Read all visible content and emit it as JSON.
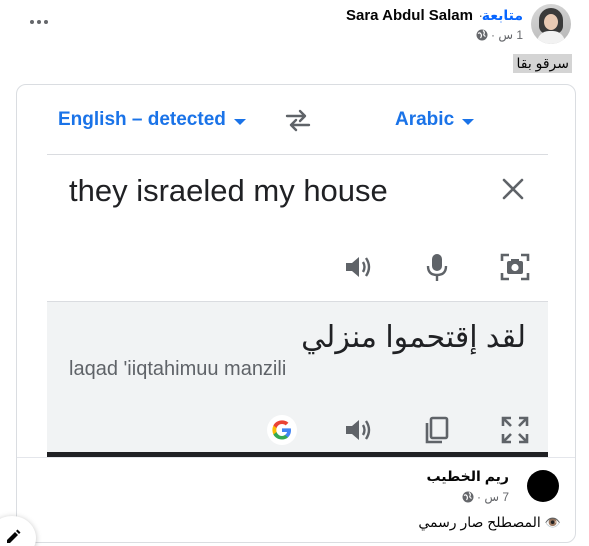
{
  "post": {
    "author": "Sara Abdul Salam",
    "separator": "·",
    "follow_label": "متابعة",
    "time": "1 س ·",
    "privacy_icon": "globe-icon",
    "more_icon": "more-options-icon",
    "caption": "سرقو بقا"
  },
  "translate": {
    "source_language": "English – detected",
    "target_language": "Arabic",
    "source_text": "they israeled my house",
    "translated_text": "لقد إقتحموا منزلي",
    "romanization": "laqad 'iiqtahimuu manzili",
    "accent_color": "#1a73e8"
  },
  "comment": {
    "name": "ريم الخطيب",
    "time": "7 س ·",
    "text": "المصطلح صار رسمي",
    "emoji": "👁️"
  }
}
